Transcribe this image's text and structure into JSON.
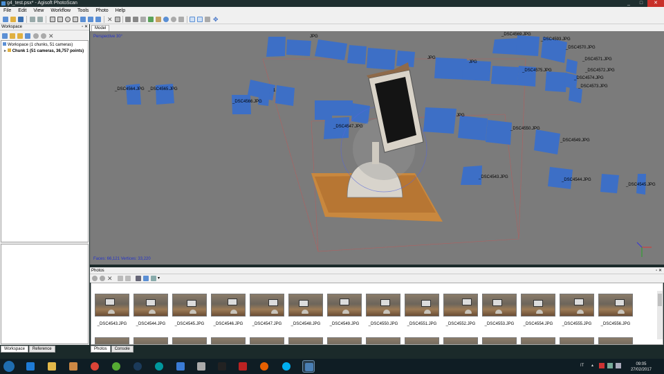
{
  "window": {
    "title": "g4_test.psx* - Agisoft PhotoScan",
    "controls": [
      "_",
      "□",
      "✕"
    ]
  },
  "menu": [
    "File",
    "Edit",
    "View",
    "Workflow",
    "Tools",
    "Photo",
    "Help"
  ],
  "workspace": {
    "header": "Workspace",
    "root": "Workspace (1 chunks, 51 cameras)",
    "chunk": "Chunk 1 (51 cameras, 36,757 points)",
    "tabs": [
      "Workspace",
      "Reference"
    ]
  },
  "model": {
    "tab": "Model",
    "perspective": "Perspective 30°",
    "stats": "Faces: 66,121  Vertices: 33,220",
    "camera_labels": [
      "_DSC4569.JPG",
      "_DSC4593.JPG",
      "_DSC4570.JPG",
      "_DSC4571.JPG",
      "_DSC4572.JPG",
      "_DSC4574.JPG",
      "_DSC4575.JPG",
      "_DSC4573.JPG",
      "_DSC4564.JPG",
      "_DSC4565.JPG",
      "_DSC4566.JPG",
      "_DSC4547.JPG",
      "_DSC4550.JPG",
      "_DSC4549.JPG",
      "_DSC4543.JPG",
      "_DSC4544.JPG",
      "_DSC4545.JPG",
      "1",
      "JPG",
      "JPG",
      "JPG",
      "JPG"
    ]
  },
  "photos": {
    "header": "Photos",
    "tabs": [
      "Photos",
      "Console"
    ],
    "files": [
      "_DSC4543.JPG",
      "_DSC4544.JPG",
      "_DSC4545.JPG",
      "_DSC4546.JPG",
      "_DSC4547.JPG",
      "_DSC4548.JPG",
      "_DSC4549.JPG",
      "_DSC4550.JPG",
      "_DSC4551.JPG",
      "_DSC4552.JPG",
      "_DSC4553.JPG",
      "_DSC4554.JPG",
      "_DSC4555.JPG",
      "_DSC4556.JPG"
    ]
  },
  "taskbar": {
    "lang": "IT",
    "time": "09:05",
    "date": "27/02/2017",
    "apps": [
      "internet-explorer-icon",
      "file-explorer-icon",
      "media-player-icon",
      "chrome-icon",
      "utorrent-icon",
      "steam-icon",
      "arduino-icon",
      "flash-icon",
      "calculator-icon",
      "cmd-icon",
      "filezilla-icon",
      "firefox-icon",
      "skype-icon",
      "photoscan-icon"
    ]
  },
  "colors": {
    "camera_plane": "#3d6fc6",
    "viewport_bg": "#7b7b7b",
    "label_blue": "#2432c8",
    "taskbar": "#0f1d24"
  }
}
